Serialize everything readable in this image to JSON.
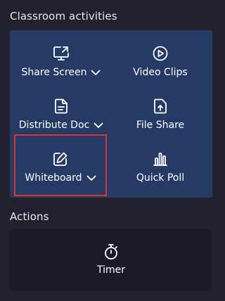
{
  "sections": {
    "classroom_title": "Classroom activities",
    "actions_title": "Actions"
  },
  "tiles": [
    {
      "label": "Share Screen",
      "icon": "monitor-share-icon",
      "dropdown": true
    },
    {
      "label": "Video Clips",
      "icon": "play-circle-icon",
      "dropdown": false
    },
    {
      "label": "Distribute Doc",
      "icon": "document-icon",
      "dropdown": true
    },
    {
      "label": "File Share",
      "icon": "file-upload-icon",
      "dropdown": false
    },
    {
      "label": "Whiteboard",
      "icon": "whiteboard-pen-icon",
      "dropdown": true,
      "highlighted": true
    },
    {
      "label": "Quick Poll",
      "icon": "bar-chart-icon",
      "dropdown": false
    }
  ],
  "actions": [
    {
      "label": "Timer",
      "icon": "stopwatch-icon"
    }
  ],
  "colors": {
    "background": "#22222e",
    "grid_panel": "#253a65",
    "actions_panel": "#1a1a28",
    "highlight": "#e0322f"
  }
}
